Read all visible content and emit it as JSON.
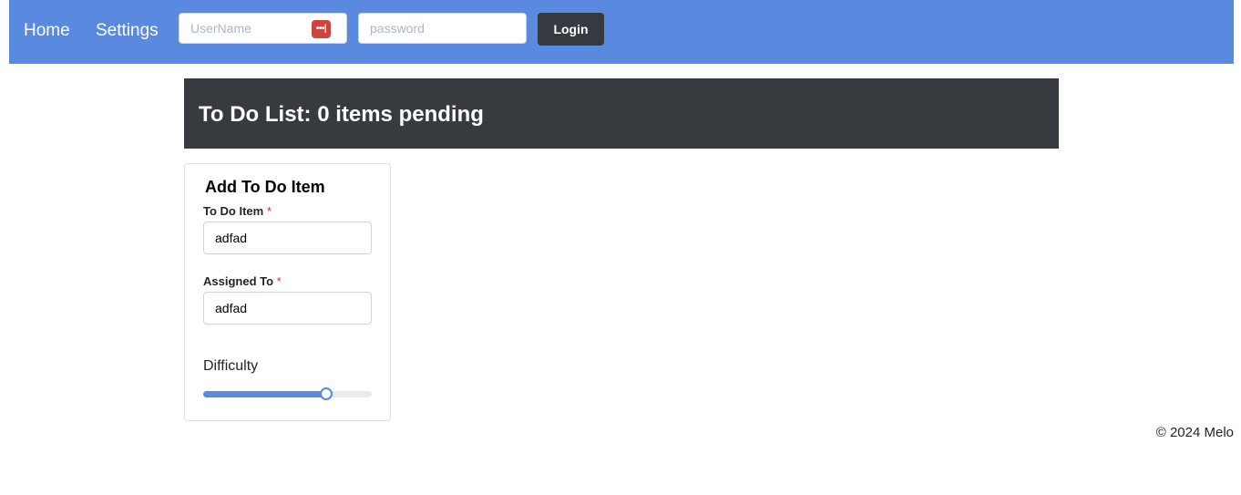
{
  "nav": {
    "home_label": "Home",
    "settings_label": "Settings",
    "username_placeholder": "UserName",
    "password_placeholder": "password",
    "login_label": "Login",
    "pw_manager_icon_glyph": "•••|",
    "pw_manager_icon": "password-manager-icon"
  },
  "header": {
    "title": "To Do List: 0 items pending"
  },
  "form": {
    "title": "Add To Do Item",
    "todo_label": "To Do Item",
    "todo_value": "adfad",
    "assigned_label": "Assigned To",
    "assigned_value": "adfad",
    "required_mark": "*",
    "difficulty_label": "Difficulty",
    "difficulty_fraction": 0.73
  },
  "footer": {
    "text": "© 2024 Melo"
  },
  "colors": {
    "accent": "#5a8ae0",
    "header_bg": "#373a3f",
    "login_bg": "#343a40",
    "required": "#e03131"
  }
}
